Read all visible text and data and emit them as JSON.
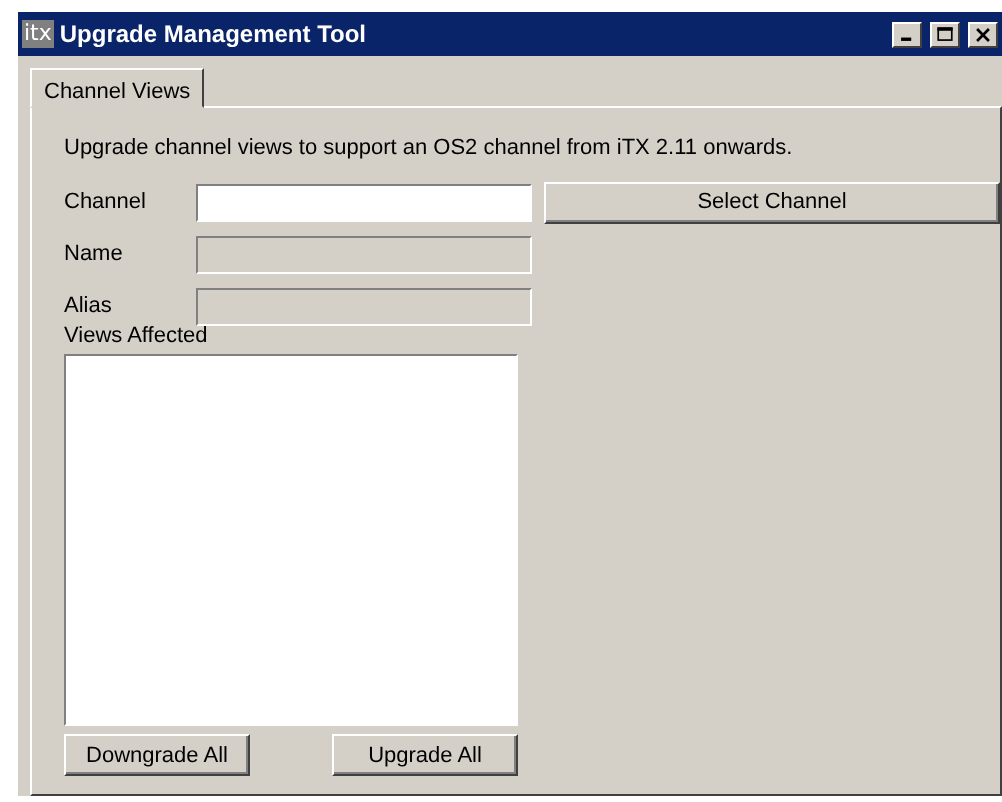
{
  "window": {
    "logo": "itx",
    "title": "Upgrade Management Tool"
  },
  "tabs": [
    {
      "label": "Channel Views",
      "selected": true
    }
  ],
  "description": "Upgrade channel views to support an OS2 channel from iTX 2.11 onwards.",
  "fields": [
    {
      "label": "Channel",
      "disabled": false
    },
    {
      "label": "Name",
      "disabled": true
    },
    {
      "label": "Alias",
      "disabled": true
    }
  ],
  "select_button": "Select Channel",
  "views_affected": {
    "label": "Views Affected"
  },
  "buttons": [
    "Downgrade All",
    "Upgrade All"
  ]
}
